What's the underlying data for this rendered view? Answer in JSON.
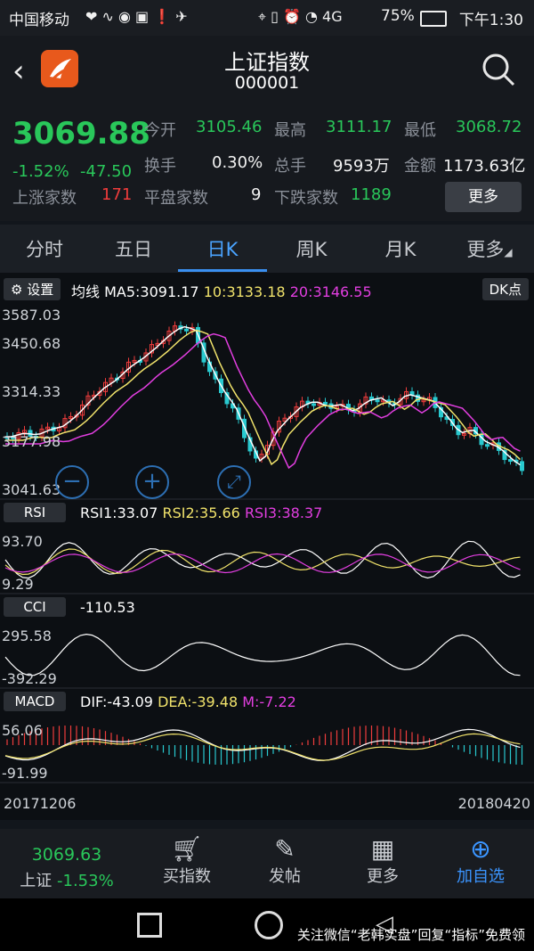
{
  "status_bar": {
    "carrier": "中国移动",
    "battery": "75%",
    "time": "下午1:30",
    "network": "4G"
  },
  "header": {
    "title": "上证指数",
    "code": "000001"
  },
  "quote": {
    "price": "3069.88",
    "change_pct": "-1.52%",
    "change": "-47.50",
    "open_label": "今开",
    "open": "3105.46",
    "high_label": "最高",
    "high": "3111.17",
    "low_label": "最低",
    "low": "3068.72",
    "turnover_label": "换手",
    "turnover": "0.30%",
    "volume_label": "总手",
    "volume": "9593万",
    "amount_label": "金额",
    "amount": "1173.63亿",
    "rise_label": "上涨家数",
    "rise": "171",
    "flat_label": "平盘家数",
    "flat": "9",
    "fall_label": "下跌家数",
    "fall": "1189",
    "more": "更多"
  },
  "tabs": [
    "分时",
    "五日",
    "日K",
    "周K",
    "月K",
    "更多"
  ],
  "chart": {
    "settings": "设置",
    "ma_label": "均线",
    "ma5": "MA5:3091.17",
    "ma10": "10:3133.18",
    "ma20": "20:3146.55",
    "dk": "DK点",
    "price_ticks": [
      "3587.03",
      "3450.68",
      "3314.33",
      "3177.98",
      "3041.63"
    ],
    "rsi": {
      "btn": "RSI",
      "rsi1": "RSI1:33.07",
      "rsi2": "RSI2:35.66",
      "rsi3": "RSI3:38.37",
      "hi": "93.70",
      "lo": "9.29"
    },
    "cci": {
      "btn": "CCI",
      "value": "-110.53",
      "hi": "295.58",
      "lo": "-392.29"
    },
    "macd": {
      "btn": "MACD",
      "dif": "DIF:-43.09",
      "dea": "DEA:-39.48",
      "m": "M:-7.22",
      "hi": "56.06",
      "lo": "-91.99"
    },
    "date_start": "20171206",
    "date_end": "20180420",
    "colors": {
      "up": "#f03c3c",
      "down": "#29c9cf",
      "ma5": "#ffffff",
      "ma10": "#f1e36b",
      "ma20": "#e23ee0"
    }
  },
  "bottom": {
    "index_price": "3069.63",
    "index_name": "上证",
    "index_change": "-1.53%",
    "items": [
      "买指数",
      "发帖",
      "更多",
      "加自选"
    ]
  },
  "watermark": "关注微信“老韩实盘”回复“指标”免费领"
}
